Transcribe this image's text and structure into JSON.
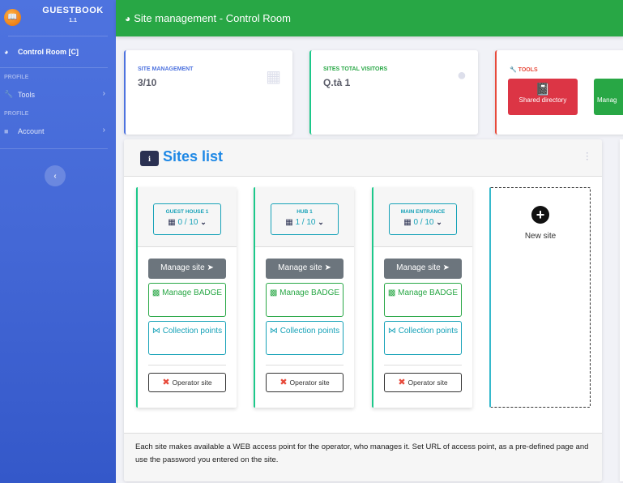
{
  "sidebar": {
    "brand_title": "GUESTBOOK",
    "brand_version": "1.1",
    "active_item": {
      "label": "Control Room [C]",
      "icon": "tachometer-icon"
    },
    "sections": [
      {
        "heading": "PROFILE",
        "item": {
          "label": "Tools",
          "icon": "wrench-icon"
        }
      },
      {
        "heading": "PROFILE",
        "item": {
          "label": "Account",
          "icon": "folder-icon"
        }
      }
    ],
    "toggle_icon": "chevron-left-icon"
  },
  "topbar": {
    "title": "Site management - Control Room",
    "icon": "tachometer-icon"
  },
  "stats": [
    {
      "label": "SITE MANAGEMENT",
      "value": "3/10",
      "icon": "building-icon",
      "accent": "#4e73df"
    },
    {
      "label": "SITES TOTAL VISITORS",
      "value": "Q.tà 1",
      "icon": "user-icon",
      "accent": "#1cc88a"
    }
  ],
  "tools": {
    "label": "TOOLS",
    "buttons": [
      {
        "label": "Shared directory",
        "color": "#dc3545",
        "icon": "address-book-icon"
      },
      {
        "label": "Manag",
        "color": "#28a745",
        "icon": "address-book-icon"
      }
    ]
  },
  "sites_panel": {
    "title": "Sites list",
    "info_icon": "i",
    "sites": [
      {
        "name": "GUEST HOUSE 1",
        "count": "0 / 10",
        "manage_label": "Manage site",
        "badge_label": "Manage BADGE",
        "collection_label": "Collection points",
        "operator_label": "Operator site"
      },
      {
        "name": "HUB 1",
        "count": "1 / 10",
        "manage_label": "Manage site",
        "badge_label": "Manage BADGE",
        "collection_label": "Collection points",
        "operator_label": "Operator site"
      },
      {
        "name": "MAIN ENTRANCE",
        "count": "0 / 10",
        "manage_label": "Manage site",
        "badge_label": "Manage BADGE",
        "collection_label": "Collection points",
        "operator_label": "Operator site"
      }
    ],
    "new_site_label": "New site",
    "footer_text": "Each site makes available a WEB access point for the operator, who manages it. Set URL of access point, as a pre-defined page and use the password you entered on the site."
  }
}
